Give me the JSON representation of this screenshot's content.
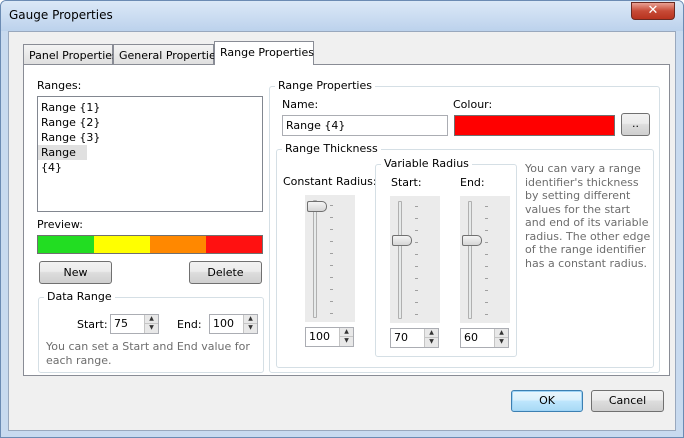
{
  "window": {
    "title": "Gauge Properties",
    "close_glyph": "✕"
  },
  "tabs": [
    "Panel Properties",
    "General Properties",
    "Range Properties"
  ],
  "active_tab": "Range Properties",
  "ranges": {
    "label": "Ranges:",
    "items": [
      "Range {1}",
      "Range {2}",
      "Range {3}",
      "Range {4}"
    ],
    "selected": "Range {4}"
  },
  "preview": {
    "label": "Preview:",
    "colors": [
      "#22dd22",
      "#ffff00",
      "#ff8800",
      "#ff1111"
    ]
  },
  "buttons": {
    "new": "New",
    "delete": "Delete",
    "ok": "OK",
    "cancel": "Cancel",
    "colour_picker": ".."
  },
  "data_range": {
    "title": "Data Range",
    "start_label": "Start:",
    "start_value": "75",
    "end_label": "End:",
    "end_value": "100",
    "help": "You can set a Start and End value for each range."
  },
  "range_properties": {
    "title": "Range Properties",
    "name_label": "Name:",
    "name_value": "Range {4}",
    "colour_label": "Colour:",
    "colour_value": "#ff0000"
  },
  "range_thickness": {
    "title": "Range Thickness",
    "constant_label": "Constant Radius:",
    "constant_value": "100",
    "variable_title": "Variable Radius",
    "start_label": "Start:",
    "start_value": "70",
    "end_label": "End:",
    "end_value": "60",
    "help": "You can vary a range identifier's thickness by setting different values for the start and end of its variable radius. The other edge of the range identifier has a constant radius."
  },
  "icons": {
    "spin_up": "▲",
    "spin_down": "▼"
  }
}
